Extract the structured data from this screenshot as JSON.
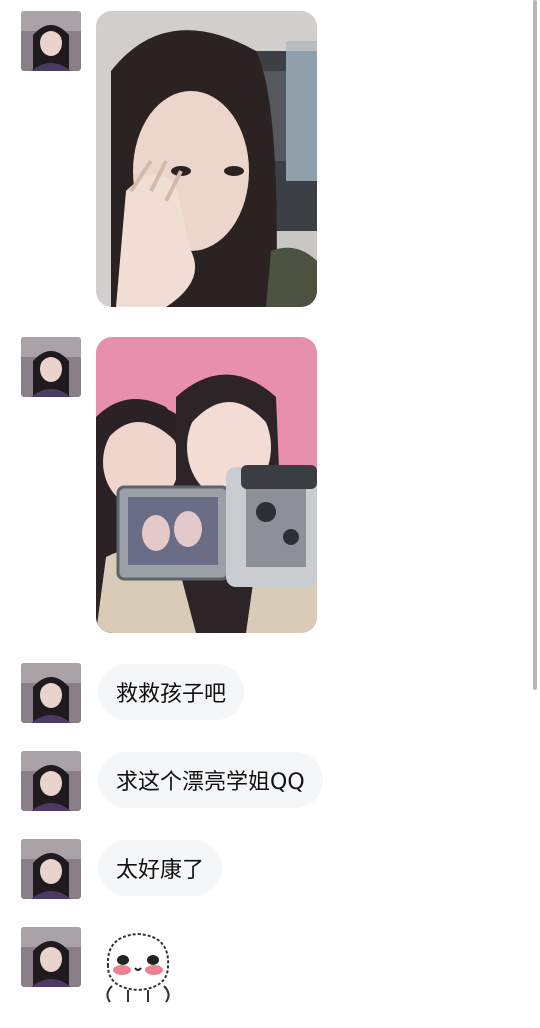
{
  "messages": [
    {
      "type": "image",
      "subject": "selfie-covering-face",
      "alt": ""
    },
    {
      "type": "image",
      "subject": "two-girls-with-camcorder",
      "alt": ""
    },
    {
      "type": "text",
      "text": "救救孩子吧"
    },
    {
      "type": "text",
      "text": "求这个漂亮学姐QQ"
    },
    {
      "type": "text",
      "text": "太好康了"
    },
    {
      "type": "sticker",
      "icon": "blushing-face-sticker-icon"
    }
  ],
  "colors": {
    "background": "#ffffff",
    "bubble": "#f5f6f8",
    "text": "#111111",
    "scrollbar": "#b7b7b7"
  }
}
